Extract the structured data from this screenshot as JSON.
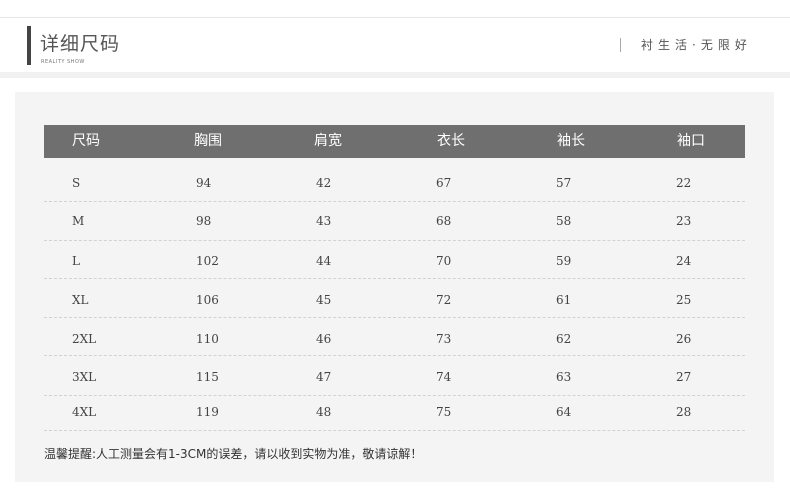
{
  "header": {
    "title": "详细尺码",
    "subtitle": "REALITY SHOW",
    "slogan": "衬生活·无限好"
  },
  "table": {
    "headers": [
      "尺码",
      "胸围",
      "肩宽",
      "衣长",
      "袖长",
      "袖口"
    ],
    "rows": [
      [
        "S",
        "94",
        "42",
        "67",
        "57",
        "22"
      ],
      [
        "M",
        "98",
        "43",
        "68",
        "58",
        "23"
      ],
      [
        "L",
        "102",
        "44",
        "70",
        "59",
        "24"
      ],
      [
        "XL",
        "106",
        "45",
        "72",
        "61",
        "25"
      ],
      [
        "2XL",
        "110",
        "46",
        "73",
        "62",
        "26"
      ],
      [
        "3XL",
        "115",
        "47",
        "74",
        "63",
        "27"
      ],
      [
        "4XL",
        "119",
        "48",
        "75",
        "64",
        "28"
      ]
    ]
  },
  "note": "温馨提醒:人工测量会有1-3CM的误差，请以收到实物为准，敬请谅解！"
}
